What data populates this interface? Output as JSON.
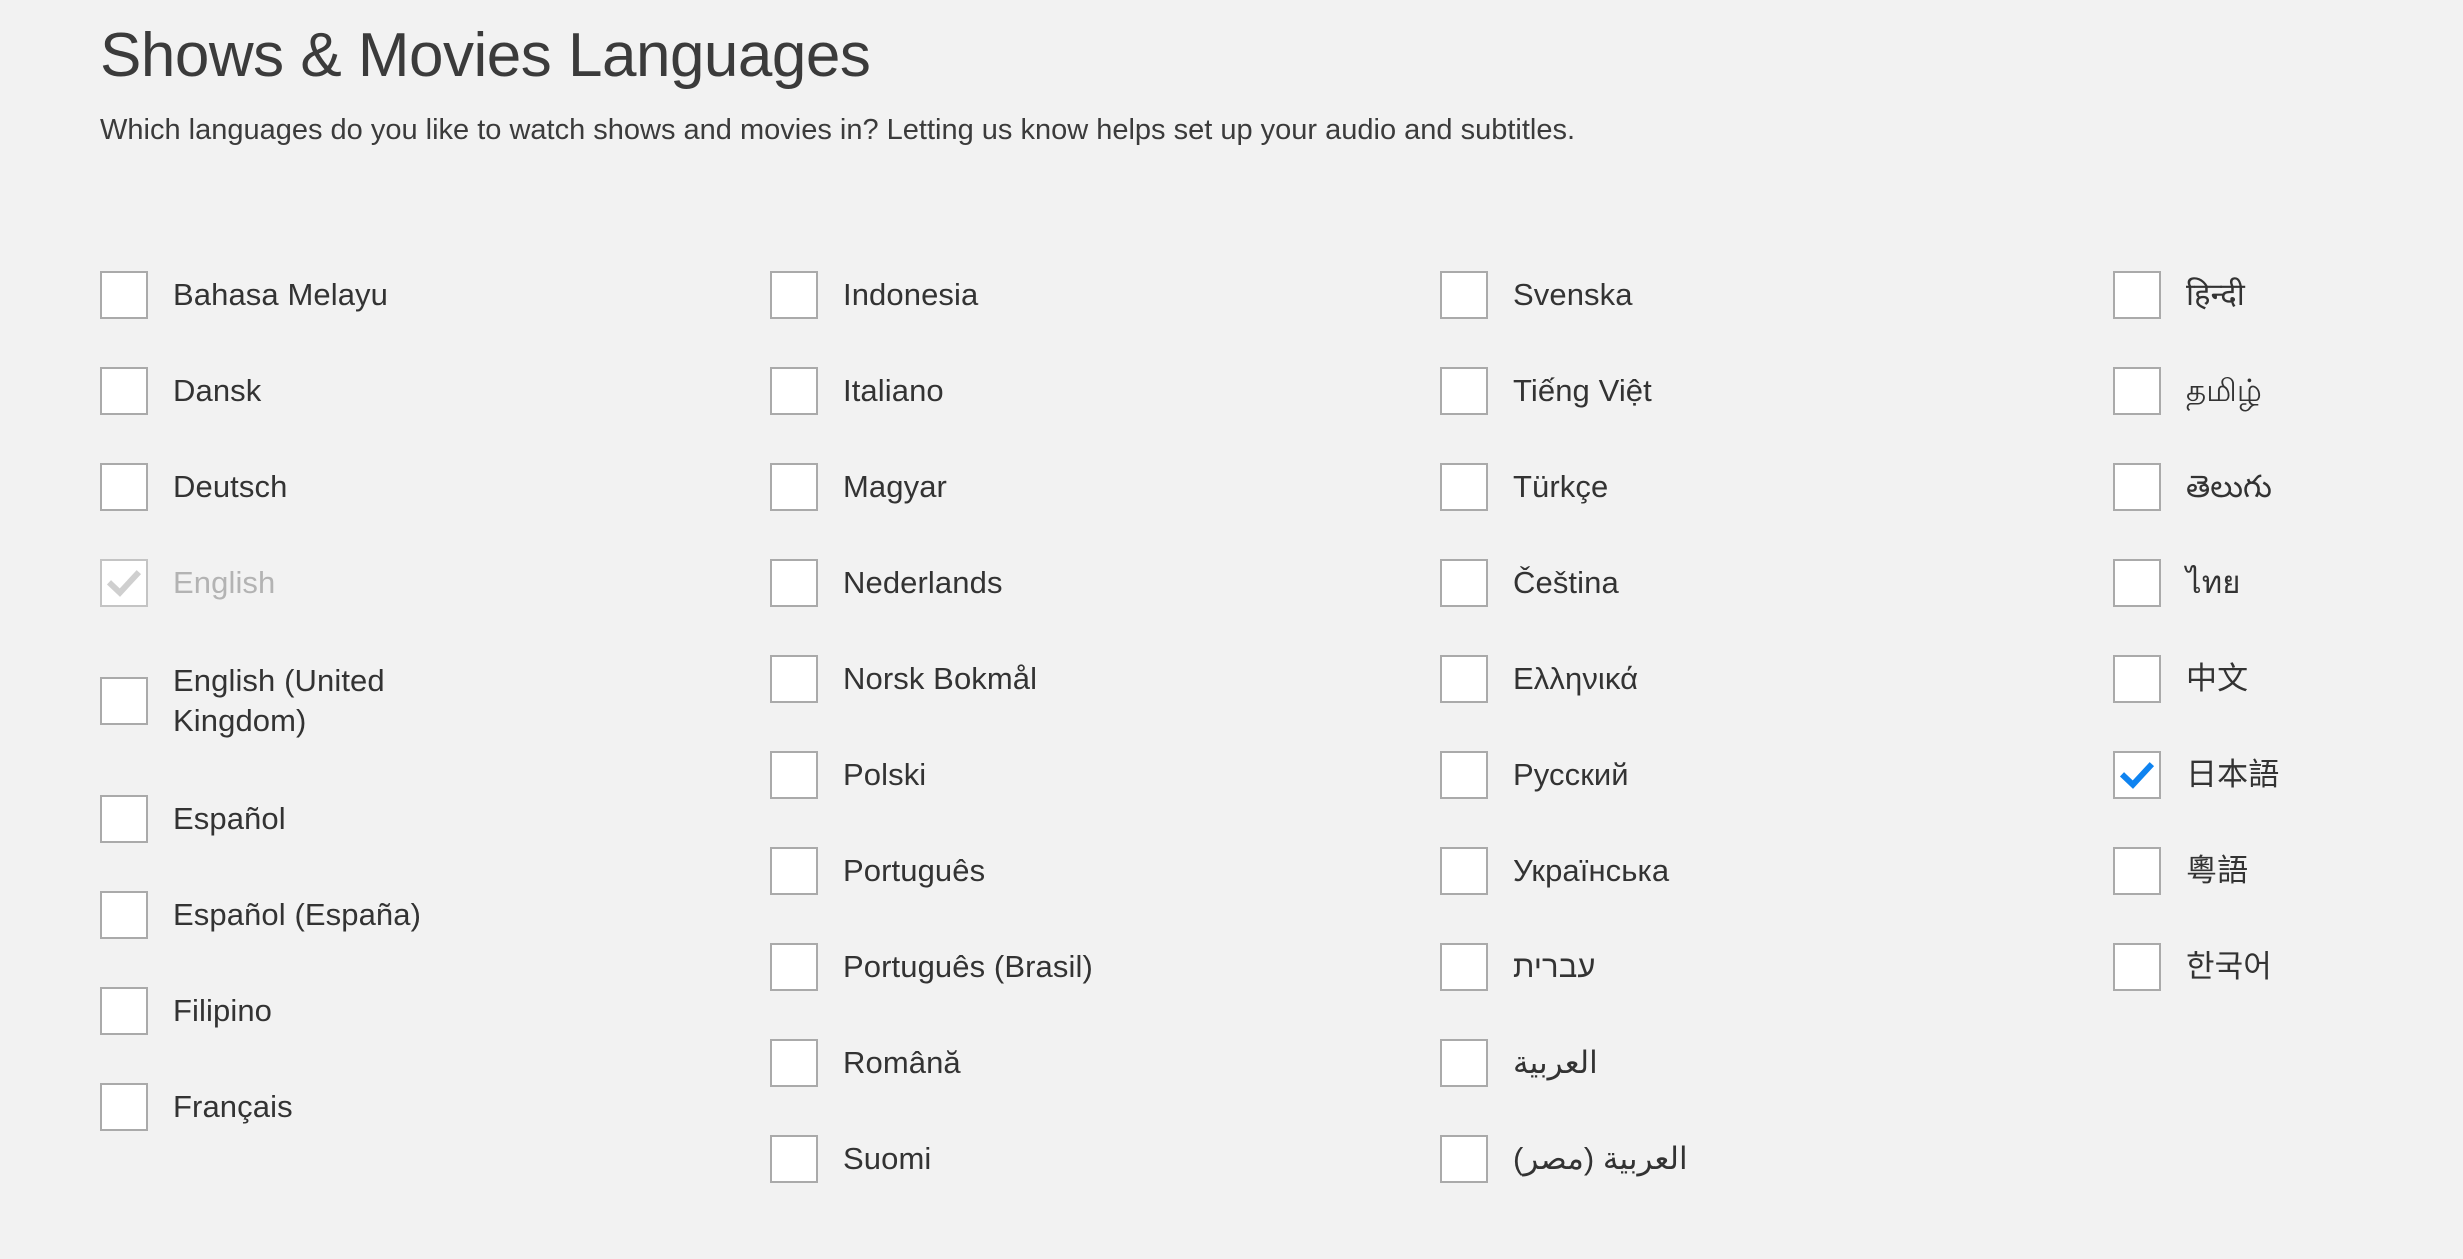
{
  "header": {
    "title": "Shows & Movies Languages",
    "subtitle": "Which languages do you like to watch shows and movies in? Letting us know helps set up your audio and subtitles."
  },
  "theme": {
    "background": "#f2f2f2",
    "text": "#333333",
    "disabled_text": "#b3b3b3",
    "checkbox_border": "#aaaaaa",
    "checkbox_fill": "#ffffff",
    "check_active": "#0f83f0",
    "check_disabled": "#cfcfcf"
  },
  "columns": [
    {
      "name": "column-1",
      "items": [
        {
          "label": "Bahasa Melayu",
          "checked": false,
          "disabled": false,
          "rtl": false,
          "two_line": false
        },
        {
          "label": "Dansk",
          "checked": false,
          "disabled": false,
          "rtl": false,
          "two_line": false
        },
        {
          "label": "Deutsch",
          "checked": false,
          "disabled": false,
          "rtl": false,
          "two_line": false
        },
        {
          "label": "English",
          "checked": true,
          "disabled": true,
          "rtl": false,
          "two_line": false
        },
        {
          "label": "English (United Kingdom)",
          "checked": false,
          "disabled": false,
          "rtl": false,
          "two_line": true
        },
        {
          "label": "Español",
          "checked": false,
          "disabled": false,
          "rtl": false,
          "two_line": false
        },
        {
          "label": "Español (España)",
          "checked": false,
          "disabled": false,
          "rtl": false,
          "two_line": false
        },
        {
          "label": "Filipino",
          "checked": false,
          "disabled": false,
          "rtl": false,
          "two_line": false
        },
        {
          "label": "Français",
          "checked": false,
          "disabled": false,
          "rtl": false,
          "two_line": false
        }
      ]
    },
    {
      "name": "column-2",
      "items": [
        {
          "label": "Indonesia",
          "checked": false,
          "disabled": false,
          "rtl": false,
          "two_line": false
        },
        {
          "label": "Italiano",
          "checked": false,
          "disabled": false,
          "rtl": false,
          "two_line": false
        },
        {
          "label": "Magyar",
          "checked": false,
          "disabled": false,
          "rtl": false,
          "two_line": false
        },
        {
          "label": "Nederlands",
          "checked": false,
          "disabled": false,
          "rtl": false,
          "two_line": false
        },
        {
          "label": "Norsk Bokmål",
          "checked": false,
          "disabled": false,
          "rtl": false,
          "two_line": false
        },
        {
          "label": "Polski",
          "checked": false,
          "disabled": false,
          "rtl": false,
          "two_line": false
        },
        {
          "label": "Português",
          "checked": false,
          "disabled": false,
          "rtl": false,
          "two_line": false
        },
        {
          "label": "Português (Brasil)",
          "checked": false,
          "disabled": false,
          "rtl": false,
          "two_line": false
        },
        {
          "label": "Română",
          "checked": false,
          "disabled": false,
          "rtl": false,
          "two_line": false
        },
        {
          "label": "Suomi",
          "checked": false,
          "disabled": false,
          "rtl": false,
          "two_line": false
        }
      ]
    },
    {
      "name": "column-3",
      "items": [
        {
          "label": "Svenska",
          "checked": false,
          "disabled": false,
          "rtl": false,
          "two_line": false
        },
        {
          "label": "Tiếng Việt",
          "checked": false,
          "disabled": false,
          "rtl": false,
          "two_line": false
        },
        {
          "label": "Türkçe",
          "checked": false,
          "disabled": false,
          "rtl": false,
          "two_line": false
        },
        {
          "label": "Čeština",
          "checked": false,
          "disabled": false,
          "rtl": false,
          "two_line": false
        },
        {
          "label": "Ελληνικά",
          "checked": false,
          "disabled": false,
          "rtl": false,
          "two_line": false
        },
        {
          "label": "Русский",
          "checked": false,
          "disabled": false,
          "rtl": false,
          "two_line": false
        },
        {
          "label": "Українська",
          "checked": false,
          "disabled": false,
          "rtl": false,
          "two_line": false
        },
        {
          "label": "עברית",
          "checked": false,
          "disabled": false,
          "rtl": true,
          "two_line": false
        },
        {
          "label": "العربية",
          "checked": false,
          "disabled": false,
          "rtl": true,
          "two_line": false
        },
        {
          "label": "العربية (مصر)",
          "checked": false,
          "disabled": false,
          "rtl": true,
          "two_line": false
        }
      ]
    },
    {
      "name": "column-4",
      "items": [
        {
          "label": "हिन्दी",
          "checked": false,
          "disabled": false,
          "rtl": false,
          "two_line": false
        },
        {
          "label": "தமிழ்",
          "checked": false,
          "disabled": false,
          "rtl": false,
          "two_line": false
        },
        {
          "label": "తెలుగు",
          "checked": false,
          "disabled": false,
          "rtl": false,
          "two_line": false
        },
        {
          "label": "ไทย",
          "checked": false,
          "disabled": false,
          "rtl": false,
          "two_line": false
        },
        {
          "label": "中文",
          "checked": false,
          "disabled": false,
          "rtl": false,
          "two_line": false
        },
        {
          "label": "日本語",
          "checked": true,
          "disabled": false,
          "rtl": false,
          "two_line": false
        },
        {
          "label": "粵語",
          "checked": false,
          "disabled": false,
          "rtl": false,
          "two_line": false
        },
        {
          "label": "한국어",
          "checked": false,
          "disabled": false,
          "rtl": false,
          "two_line": false
        }
      ]
    }
  ]
}
